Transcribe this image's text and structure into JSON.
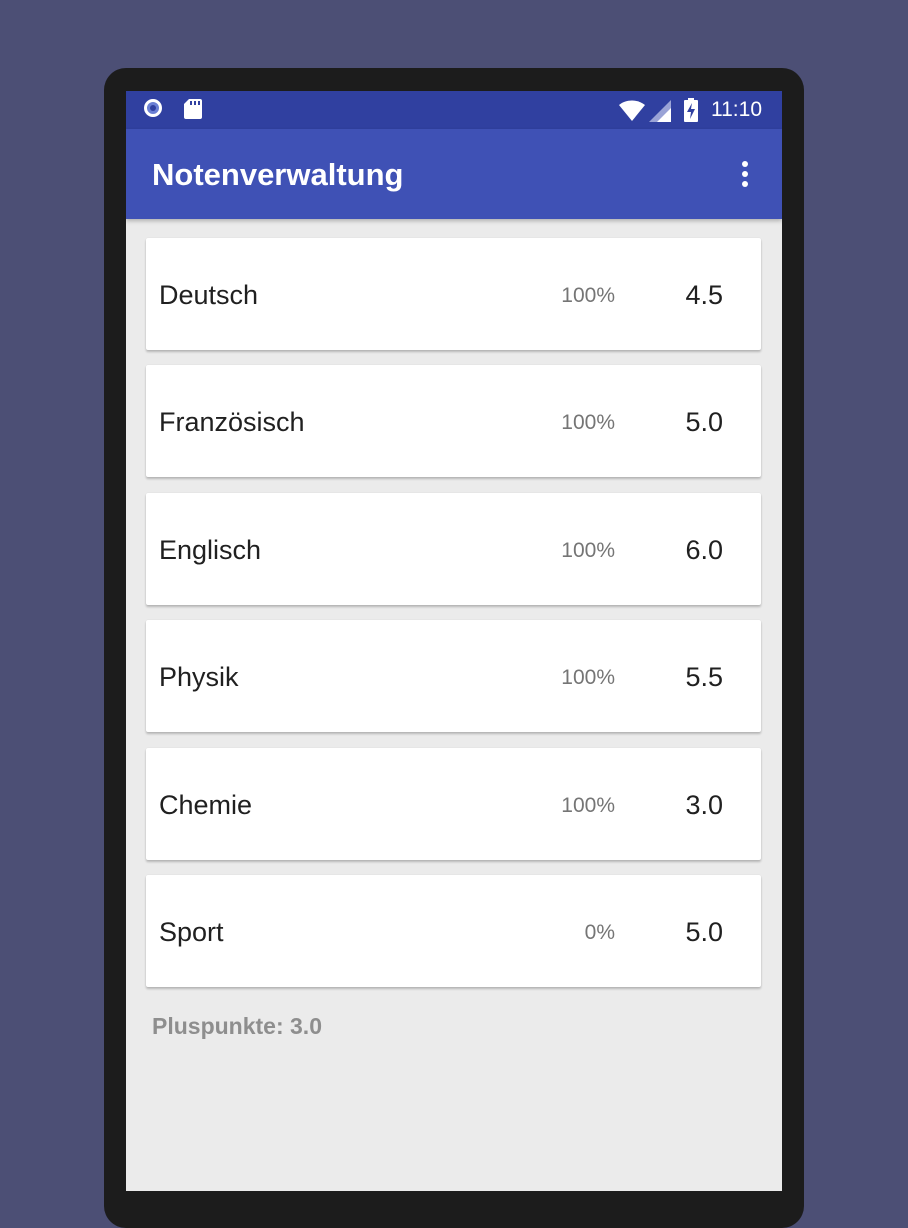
{
  "status_bar": {
    "time": "11:10",
    "icons": [
      "notification-circle-icon",
      "sd-card-icon",
      "wifi-icon",
      "cell-signal-icon",
      "battery-charging-icon"
    ]
  },
  "app_bar": {
    "title": "Notenverwaltung",
    "overflow_icon": "more-vert-icon"
  },
  "subjects": [
    {
      "name": "Deutsch",
      "weight": "100%",
      "grade": "4.5"
    },
    {
      "name": "Französisch",
      "weight": "100%",
      "grade": "5.0"
    },
    {
      "name": "Englisch",
      "weight": "100%",
      "grade": "6.0"
    },
    {
      "name": "Physik",
      "weight": "100%",
      "grade": "5.5"
    },
    {
      "name": "Chemie",
      "weight": "100%",
      "grade": "3.0"
    },
    {
      "name": "Sport",
      "weight": "0%",
      "grade": "5.0"
    }
  ],
  "footer": {
    "pluspunkte": "Pluspunkte: 3.0"
  },
  "colors": {
    "status_bar": "#3040a0",
    "app_bar": "#3f51b5",
    "background": "#ebebeb",
    "page_background": "#4c4f75"
  }
}
